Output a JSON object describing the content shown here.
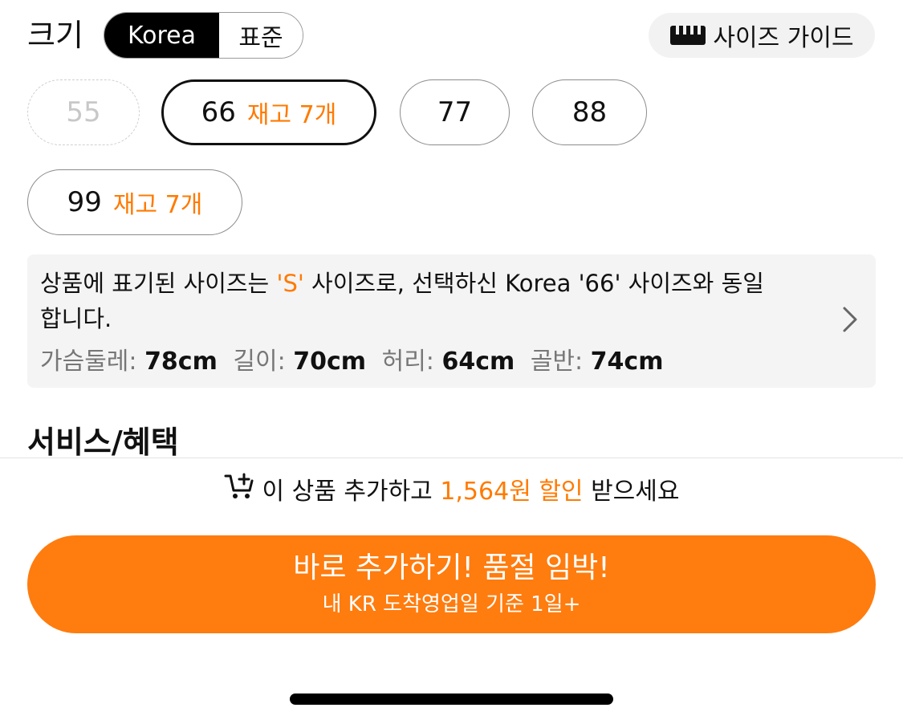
{
  "size": {
    "title": "크기",
    "standards": [
      "Korea",
      "표준"
    ],
    "selected_standard": "Korea",
    "guide_label": "사이즈 가이드",
    "guide_icon": "ruler-icon",
    "options": [
      {
        "label": "55",
        "stock": "",
        "state": "disabled"
      },
      {
        "label": "66",
        "stock": "재고 7개",
        "state": "selected"
      },
      {
        "label": "77",
        "stock": "",
        "state": "normal"
      },
      {
        "label": "88",
        "stock": "",
        "state": "normal"
      },
      {
        "label": "99",
        "stock": "재고 7개",
        "state": "normal"
      }
    ]
  },
  "size_info": {
    "text_before": "상품에 표기된 사이즈는 ",
    "highlight": "'S'",
    "text_after": " 사이즈로, 선택하신 Korea '66' 사이즈와 동일",
    "text_line2": "합니다.",
    "measurements": [
      {
        "label": "가슴둘레:",
        "value": "78cm"
      },
      {
        "label": "길이:",
        "value": "70cm"
      },
      {
        "label": "허리:",
        "value": "64cm"
      },
      {
        "label": "골반:",
        "value": "74cm"
      }
    ],
    "chevron_icon": "chevron-right-icon"
  },
  "section_title": "서비스/혜택",
  "promo": {
    "icon": "cart-plus-icon",
    "before": "이 상품 추가하고 ",
    "highlight": "1,564원 할인",
    "after": " 받으세요"
  },
  "cta": {
    "main": "바로 추가하기! 품절 임박!",
    "sub": "내 KR 도착영업일 기준 1일+"
  },
  "colors": {
    "accent": "#ff7a00",
    "cta_bg": "#ff7c0e",
    "toggle_selected_bg": "#000000"
  }
}
